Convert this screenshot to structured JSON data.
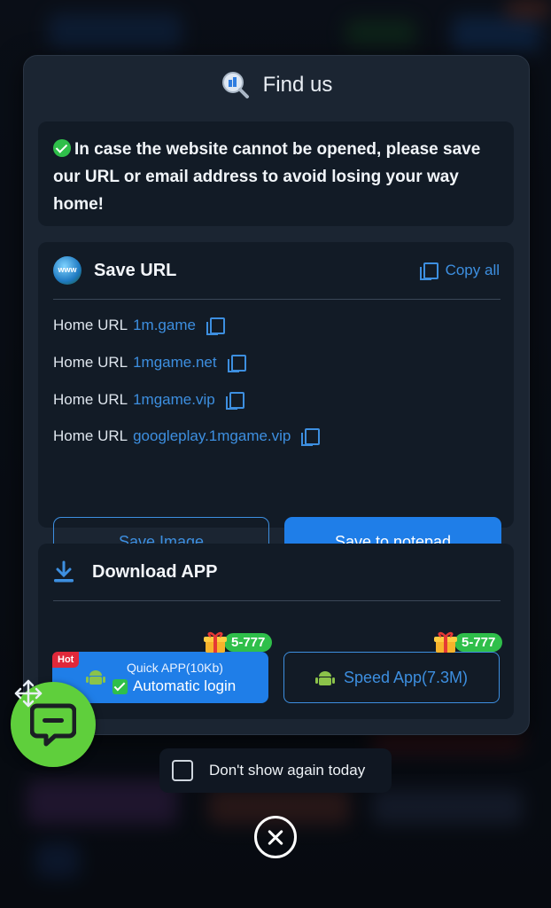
{
  "modal": {
    "title": "Find us",
    "notice": "In case the website cannot be opened, please save our URL or email address to avoid losing your way home!"
  },
  "save_url": {
    "title": "Save URL",
    "copy_all_label": "Copy all",
    "www_label": "www",
    "rows": [
      {
        "prefix": "Home URL",
        "url": "1m.game"
      },
      {
        "prefix": "Home URL",
        "url": "1mgame.net"
      },
      {
        "prefix": "Home URL",
        "url": "1mgame.vip"
      },
      {
        "prefix": "Home URL",
        "url": "googleplay.1mgame.vip"
      }
    ],
    "save_image_label": "Save Image",
    "save_notepad_label": "Save to notepad"
  },
  "download": {
    "title": "Download APP",
    "quick_app": {
      "hot": "Hot",
      "line1": "Quick APP(10Kb)",
      "line2": "Automatic login",
      "bonus": "5-777"
    },
    "speed_app": {
      "label": "Speed App(7.3M)",
      "bonus": "5-777"
    }
  },
  "footer": {
    "dont_show_label": "Don't show again today"
  },
  "colors": {
    "accent": "#1f7ee8",
    "link": "#3d8fe0",
    "success": "#2fbf4a",
    "hot": "#e0283a",
    "fab": "#5fcf3c"
  }
}
